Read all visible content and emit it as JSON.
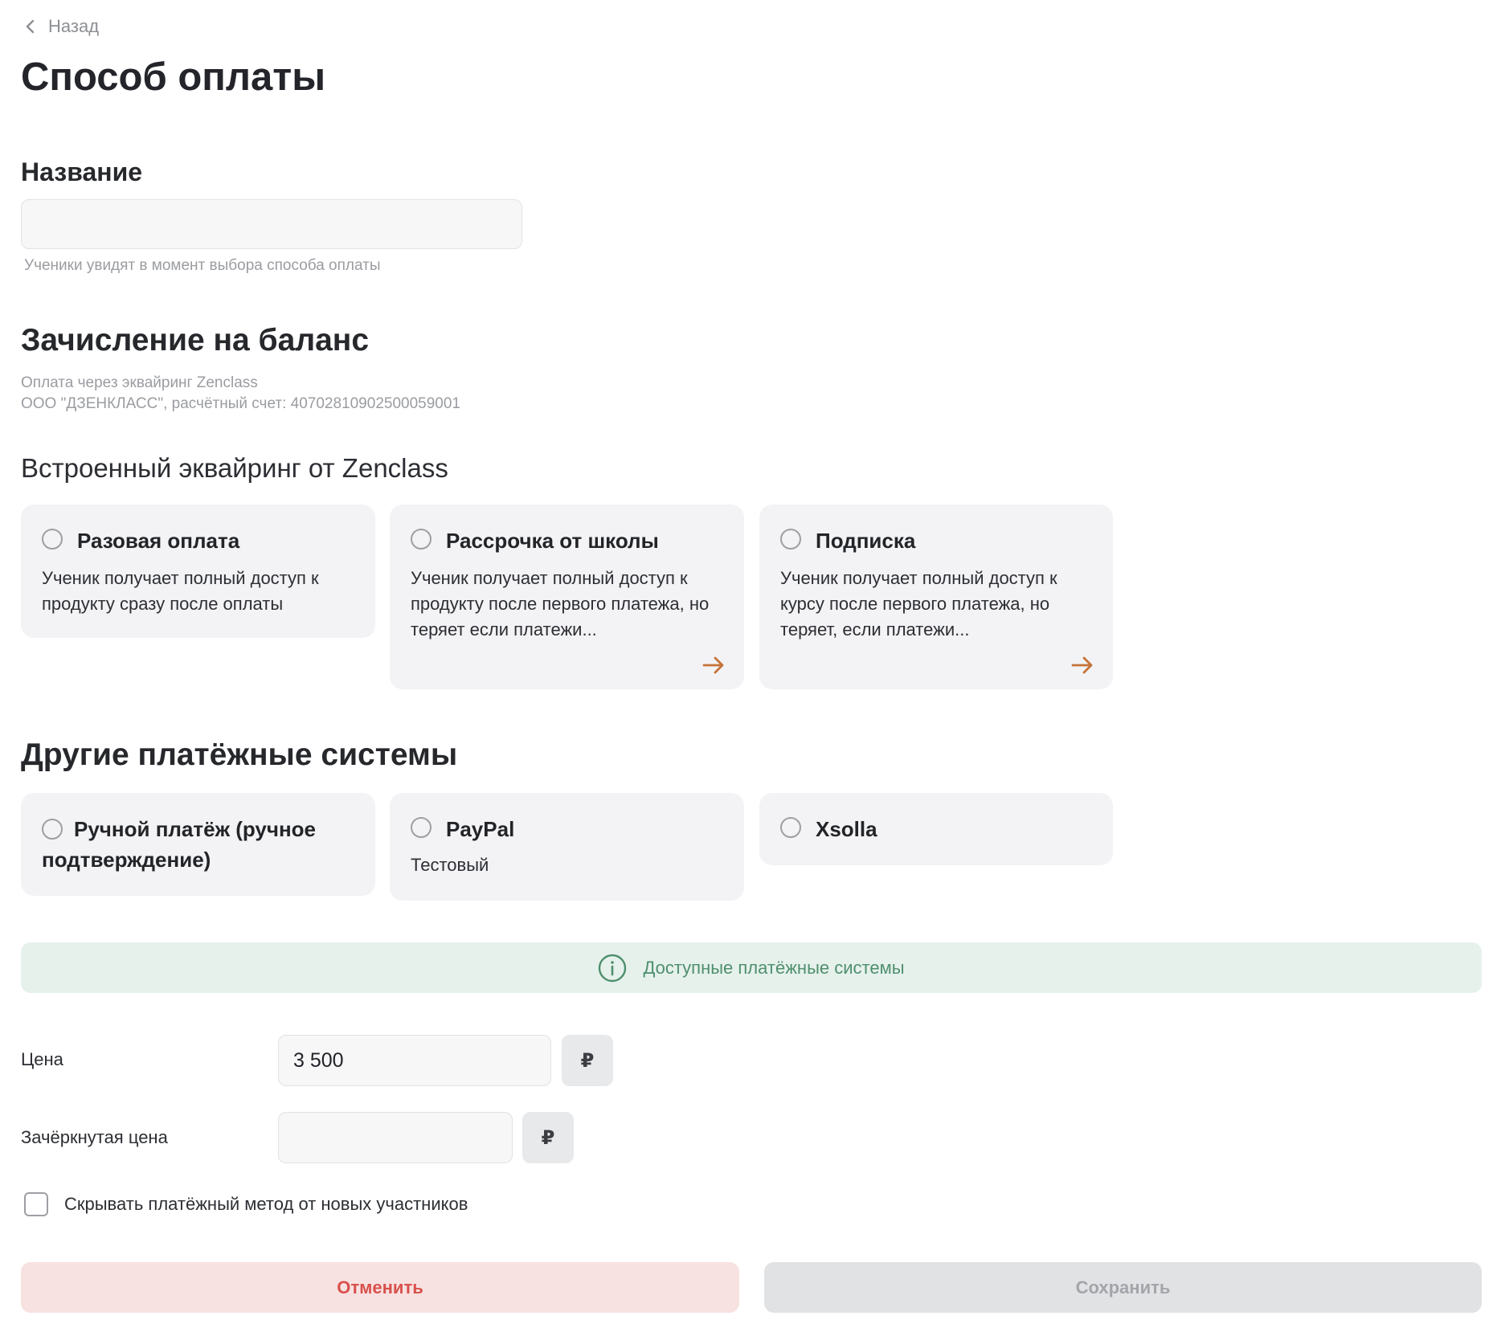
{
  "nav": {
    "back_label": "Назад"
  },
  "page_title": "Способ оплаты",
  "name_section": {
    "heading": "Название",
    "input_value": "",
    "hint": "Ученики увидят в момент выбора способа оплаты"
  },
  "balance_section": {
    "heading": "Зачисление на баланс",
    "desc_line1": "Оплата через эквайринг Zenclass",
    "desc_line2": "ООО \"ДЗЕНКЛАСС\", расчётный счет: 40702810902500059001"
  },
  "acquiring": {
    "heading": "Встроенный эквайринг от Zenclass",
    "options": [
      {
        "title": "Разовая оплата",
        "desc": "Ученик получает полный доступ к продукту сразу после оплаты",
        "selected": false
      },
      {
        "title": "Рассрочка от школы",
        "desc": "Ученик получает полный доступ к продукту после первого платежа, но теряет если платежи...",
        "selected": false,
        "arrow_icon": "arrow-right-icon"
      },
      {
        "title": "Подписка",
        "desc": "Ученик получает полный доступ к курсу после первого платежа, но теряет, если платежи...",
        "selected": false,
        "arrow_icon": "arrow-right-icon"
      }
    ]
  },
  "other_systems": {
    "heading": "Другие платёжные системы",
    "options": [
      {
        "title": "Ручной платёж (ручное подтверждение)",
        "selected": false
      },
      {
        "title": "PayPal",
        "desc": "Тестовый",
        "selected": false
      },
      {
        "title": "Xsolla",
        "selected": false
      }
    ]
  },
  "info_banner": {
    "text": "Доступные платёжные системы",
    "icon": "info-icon"
  },
  "price": {
    "label": "Цена",
    "value": "3 500",
    "currency": "₽"
  },
  "strike_price": {
    "label": "Зачёркнутая цена",
    "value": "",
    "currency": "₽"
  },
  "hide_method": {
    "label": "Скрывать платёжный метод от новых участников",
    "checked": false
  },
  "actions": {
    "cancel_label": "Отменить",
    "save_label": "Сохранить"
  },
  "colors": {
    "accent_arrow": "#c57339",
    "cancel_text": "#d8514c",
    "cancel_bg": "#f8e1e1",
    "info_text": "#4e8f6d",
    "info_bg": "#e6f1ec"
  }
}
